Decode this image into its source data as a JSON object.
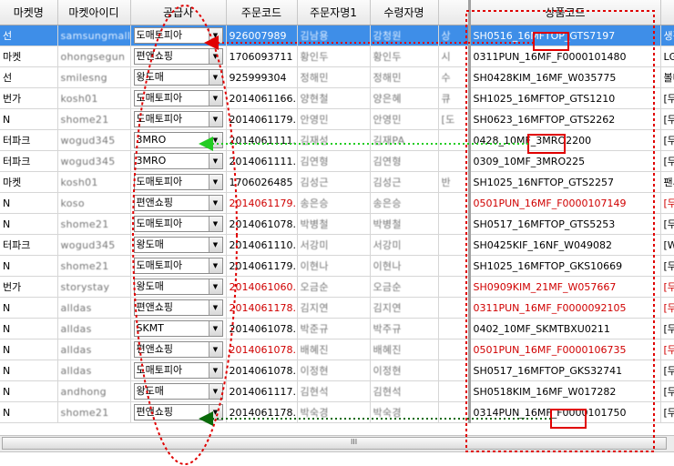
{
  "columns": [
    "마켓명",
    "마켓아이디",
    "공급사",
    "주문코드",
    "주문자명1",
    "수령자명",
    "",
    "상품코드",
    ""
  ],
  "rows": [
    {
      "market": "선",
      "id": "samsungmall",
      "supplier": "도매토피아",
      "order": "926007989",
      "buyer": "김남용",
      "receiver": "강청원",
      "mid": "상",
      "code": "SH0516_16MFTOP_GTS7197",
      "extra": "생활",
      "sel": true,
      "red": false
    },
    {
      "market": "마켓",
      "id": "ohongsegun",
      "supplier": "편앤쇼핑",
      "order": "1706093711",
      "buyer": "황인두",
      "receiver": "황인두",
      "mid": "시",
      "code": "0311PUN_16MF_F0000101480",
      "extra": "LG헤",
      "sel": false,
      "red": false
    },
    {
      "market": "선",
      "id": "smilesng",
      "supplier": "왕도매",
      "order": "925999304",
      "buyer": "정해민",
      "receiver": "정해민",
      "mid": "수",
      "code": "SH0428KIM_16MF_W035775",
      "extra": "볼마",
      "sel": false,
      "red": false
    },
    {
      "market": "번가",
      "id": "kosh01",
      "supplier": "도매토피아",
      "order": "2014061166...",
      "buyer": "양현철",
      "receiver": "양은혜",
      "mid": "큐",
      "code": "SH1025_16MFTOP_GTS1210",
      "extra": "[무",
      "sel": false,
      "red": false
    },
    {
      "market": "N",
      "id": "shome21",
      "supplier": "도매토피아",
      "order": "2014061179...",
      "buyer": "안영민",
      "receiver": "안영민",
      "mid": "[도",
      "code": "SH0623_16MFTOP_GTS2262",
      "extra": "[무",
      "sel": false,
      "red": false
    },
    {
      "market": "터파크",
      "id": "wogud345",
      "supplier": "3MRO",
      "order": "2014061111...",
      "buyer": "김재성",
      "receiver": "김재PA",
      "mid": "",
      "code": "0428_10MF_3MRO2200",
      "extra": "[무",
      "sel": false,
      "red": false
    },
    {
      "market": "터파크",
      "id": "wogud345",
      "supplier": "3MRO",
      "order": "2014061111...",
      "buyer": "김연형",
      "receiver": "김연형",
      "mid": "",
      "code": "0309_10MF_3MRO225",
      "extra": "[무",
      "sel": false,
      "red": false
    },
    {
      "market": "마켓",
      "id": "kosh01",
      "supplier": "도매토피아",
      "order": "1706026485",
      "buyer": "김성근",
      "receiver": "김성근",
      "mid": "반",
      "code": "SH1025_16NFTOP_GTS2257",
      "extra": "팬시",
      "sel": false,
      "red": false
    },
    {
      "market": "N",
      "id": "koso",
      "supplier": "편앤쇼핑",
      "order": "2014061179...",
      "buyer": "송은승",
      "receiver": "송은승",
      "mid": "",
      "code": "0501PUN_16MF_F0000107149",
      "extra": "[무",
      "sel": false,
      "red": true
    },
    {
      "market": "N",
      "id": "shome21",
      "supplier": "도매토피아",
      "order": "2014061078...",
      "buyer": "박병철",
      "receiver": "박병철",
      "mid": "",
      "code": "SH0517_16MFTOP_GTS5253",
      "extra": "[무",
      "sel": false,
      "red": false
    },
    {
      "market": "터파크",
      "id": "wogud345",
      "supplier": "왕도매",
      "order": "2014061110...",
      "buyer": "서강미",
      "receiver": "서강미",
      "mid": "",
      "code": "SH0425KIF_16NF_W049082",
      "extra": "[Wh",
      "sel": false,
      "red": false
    },
    {
      "market": "N",
      "id": "shome21",
      "supplier": "도매토피아",
      "order": "2014061179...",
      "buyer": "이현나",
      "receiver": "이현나",
      "mid": "",
      "code": "SH1025_16MFTOP_GKS10669",
      "extra": "[무",
      "sel": false,
      "red": false
    },
    {
      "market": "번가",
      "id": "storystay",
      "supplier": "왕도매",
      "order": "2014061060...",
      "buyer": "오금순",
      "receiver": "오금순",
      "mid": "",
      "code": "SH0909KIM_21MF_W057667",
      "extra": "[무",
      "sel": false,
      "red": true
    },
    {
      "market": "N",
      "id": "alldas",
      "supplier": "편앤쇼핑",
      "order": "2014061178...",
      "buyer": "김지연",
      "receiver": "김지연",
      "mid": "",
      "code": "0311PUN_16MF_F0000092105",
      "extra": "[무",
      "sel": false,
      "red": true
    },
    {
      "market": "N",
      "id": "alldas",
      "supplier": "SKMT",
      "order": "2014061078...",
      "buyer": "박준규",
      "receiver": "박주규",
      "mid": "",
      "code": "0402_10MF_SKMTBXU0211",
      "extra": "[무",
      "sel": false,
      "red": false
    },
    {
      "market": "N",
      "id": "alldas",
      "supplier": "편앤쇼핑",
      "order": "2014061078...",
      "buyer": "배혜진",
      "receiver": "배혜진",
      "mid": "",
      "code": "0501PUN_16MF_F0000106735",
      "extra": "[무",
      "sel": false,
      "red": true
    },
    {
      "market": "N",
      "id": "alldas",
      "supplier": "도매토피아",
      "order": "2014061078...",
      "buyer": "이정현",
      "receiver": "이정현",
      "mid": "",
      "code": "SH0517_16MFTOP_GKS32741",
      "extra": "[무",
      "sel": false,
      "red": false
    },
    {
      "market": "N",
      "id": "andhong",
      "supplier": "왕도매",
      "order": "2014061117...",
      "buyer": "김현석",
      "receiver": "김현석",
      "mid": "",
      "code": "SH0518KIM_16MF_W017282",
      "extra": "[무",
      "sel": false,
      "red": false
    },
    {
      "market": "N",
      "id": "shome21",
      "supplier": "편앤쇼핑",
      "order": "2014061178...",
      "buyer": "박숙경",
      "receiver": "박숙경",
      "mid": "",
      "code": "0314PUN_16MF_F0000101750",
      "extra": "[무",
      "sel": false,
      "red": false
    }
  ],
  "scrollbar": {
    "grip": "III"
  },
  "colors": {
    "select": "#3e8ee8",
    "red_annotation": "#e00000",
    "green_arrow": "#22cc22",
    "dark_green_arrow": "#0a6a0a"
  }
}
